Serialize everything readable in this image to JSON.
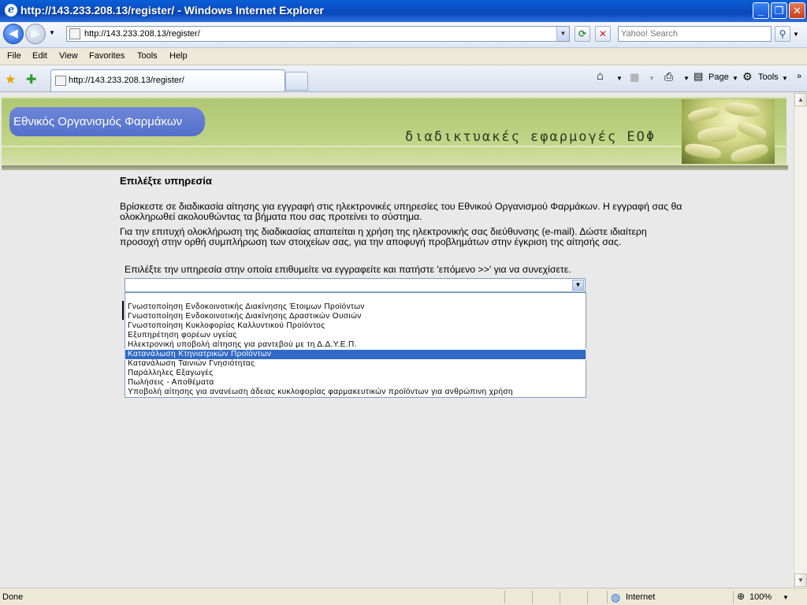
{
  "window": {
    "title": "http://143.233.208.13/register/ - Windows Internet Explorer",
    "minimize": "_",
    "restore": "❐",
    "close": "✕"
  },
  "address_bar": {
    "url": "http://143.233.208.13/register/",
    "search_placeholder": "Yahoo! Search"
  },
  "menu": [
    "File",
    "Edit",
    "View",
    "Favorites",
    "Tools",
    "Help"
  ],
  "tab": {
    "url": "http://143.233.208.13/register/"
  },
  "command_bar": {
    "page_label": "Page",
    "tools_label": "Tools"
  },
  "banner": {
    "org_name": "Εθνικός Οργανισμός Φαρμάκων",
    "apps_title": "διαδικτυακές εφαρμογές ΕΟΦ"
  },
  "main": {
    "heading": "Επιλέξτε υπηρεσία",
    "intro_1": "Βρίσκεστε σε διαδικασία αίτησης για εγγραφή στις ηλεκτρονικές υπηρεσίες του Εθνικού Οργανισμού Φαρμάκων. Η εγγραφή σας θα ολοκληρωθεί ακολουθώντας τα βήματα που σας προτείνει το σύστημα.",
    "intro_2": "Για την επιτυχή ολοκλήρωση της διαδικασίας απαιτείται η χρήση της ηλεκτρονικής σας διεύθυνσης (e-mail). Δώστε ιδιαίτερη προσοχή στην ορθή συμπλήρωση των στοιχείων σας, για την αποφυγή προβλημάτων στην έγκριση της αίτησής σας.",
    "instruction": "Επιλέξτε την υπηρεσία στην οποία επιθυμείτε να εγγραφείτε και πατήστε 'επόμενο >>' για να συνεχίσετε.",
    "select_value": "",
    "options": [
      "",
      "Γνωστοποίηση Ενδοκοινοτικής Διακίνησης Έτοιμων Προϊόντων",
      "Γνωστοποίηση Ενδοκοινοτικής Διακίνησης Δραστικών Ουσιών",
      "Γνωστοποίηση Κυκλοφορίας Καλλυντικού Προϊόντος",
      "Εξυπηρέτηση φορέων υγείας",
      "Ηλεκτρονική υποβολή αίτησης για ραντεβού με τη Δ.Δ.Υ.Ε.Π.",
      "Κατανάλωση Κτηνιατρικών Προϊόντων",
      "Κατανάλωση Ταινιών Γνησιότητας",
      "Παράλληλες Εξαγωγές",
      "Πωλήσεις - Αποθέματα",
      "Υποβολή αίτησης για ανανέωση άδειας κυκλοφορίας φαρμακευτικών προϊόντων για ανθρώπινη χρήση"
    ],
    "selected_option": "Κατανάλωση Κτηνιατρικών Προϊόντων"
  },
  "status_bar": {
    "status": "Done",
    "zone": "Internet",
    "zoom": "100%"
  },
  "colors": {
    "title_blue": "#0a5fd6",
    "banner_green": "#aec773",
    "logo_blue": "#5f7ad0",
    "selection_blue": "#316ac5"
  }
}
